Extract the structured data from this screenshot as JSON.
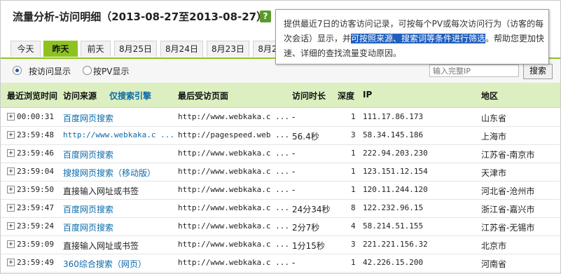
{
  "page": {
    "title": "流量分析-访问明细（2013-08-27至2013-08-27）",
    "help_icon": "?"
  },
  "tabs": [
    "今天",
    "昨天",
    "前天",
    "8月25日",
    "8月24日",
    "8月23日",
    "8月2"
  ],
  "active_tab": "昨天",
  "filter": {
    "by_visit_label": "按访问显示",
    "by_pv_label": "按PV显示",
    "selected": "按访问显示",
    "ip_placeholder": "输入完整IP",
    "search_label": "搜索"
  },
  "table": {
    "headers": {
      "time": "最近浏览时间",
      "source": "访问来源",
      "search_only": "仅搜索引擎",
      "last_page": "最后受访页面",
      "duration": "访问时长",
      "depth": "深度",
      "ip": "IP",
      "region": "地区"
    },
    "rows": [
      {
        "time": "00:00:31",
        "source": "百度网页搜索",
        "page": "http://www.webkaka.c ...",
        "duration": "-",
        "depth": "1",
        "ip": "111.17.86.173",
        "region": "山东省"
      },
      {
        "time": "23:59:48",
        "source": "http://www.webkaka.c ...",
        "page": "http://pagespeed.web ...",
        "duration": "56.4秒",
        "depth": "3",
        "ip": "58.34.145.186",
        "region": "上海市"
      },
      {
        "time": "23:59:46",
        "source": "百度网页搜索",
        "page": "http://www.webkaka.c ...",
        "duration": "-",
        "depth": "1",
        "ip": "222.94.203.230",
        "region": "江苏省-南京市"
      },
      {
        "time": "23:59:04",
        "source": "搜搜网页搜索（移动版）",
        "page": "http://www.webkaka.c ...",
        "duration": "-",
        "depth": "1",
        "ip": "123.151.12.154",
        "region": "天津市"
      },
      {
        "time": "23:59:50",
        "source": "直接输入网址或书签",
        "page": "http://www.webkaka.c ...",
        "duration": "-",
        "depth": "1",
        "ip": "120.11.244.120",
        "region": "河北省-沧州市"
      },
      {
        "time": "23:59:47",
        "source": "百度网页搜索",
        "page": "http://www.webkaka.c ...",
        "duration": "24分34秒",
        "depth": "8",
        "ip": "122.232.96.15",
        "region": "浙江省-嘉兴市"
      },
      {
        "time": "23:59:24",
        "source": "百度网页搜索",
        "page": "http://www.webkaka.c ...",
        "duration": "2分7秒",
        "depth": "4",
        "ip": "58.214.51.155",
        "region": "江苏省-无锡市"
      },
      {
        "time": "23:59:09",
        "source": "直接输入网址或书签",
        "page": "http://www.webkaka.c ...",
        "duration": "1分15秒",
        "depth": "3",
        "ip": "221.221.156.32",
        "region": "北京市"
      },
      {
        "time": "23:59:49",
        "source": "360综合搜索（网页）",
        "page": "http://www.webkaka.c ...",
        "duration": "-",
        "depth": "1",
        "ip": "42.226.15.200",
        "region": "河南省"
      }
    ]
  },
  "tooltip": {
    "line1": "提供最近7日的访客访问记录，可按每个PV或每次访问行为（访客的每",
    "line2_pre": "次会话）显示，并",
    "line2_hl": "可按照来源、搜索词等条件进行筛选",
    "line2_post": "。帮助您更加快",
    "line3": "速、详细的查找流量变动原因。"
  }
}
